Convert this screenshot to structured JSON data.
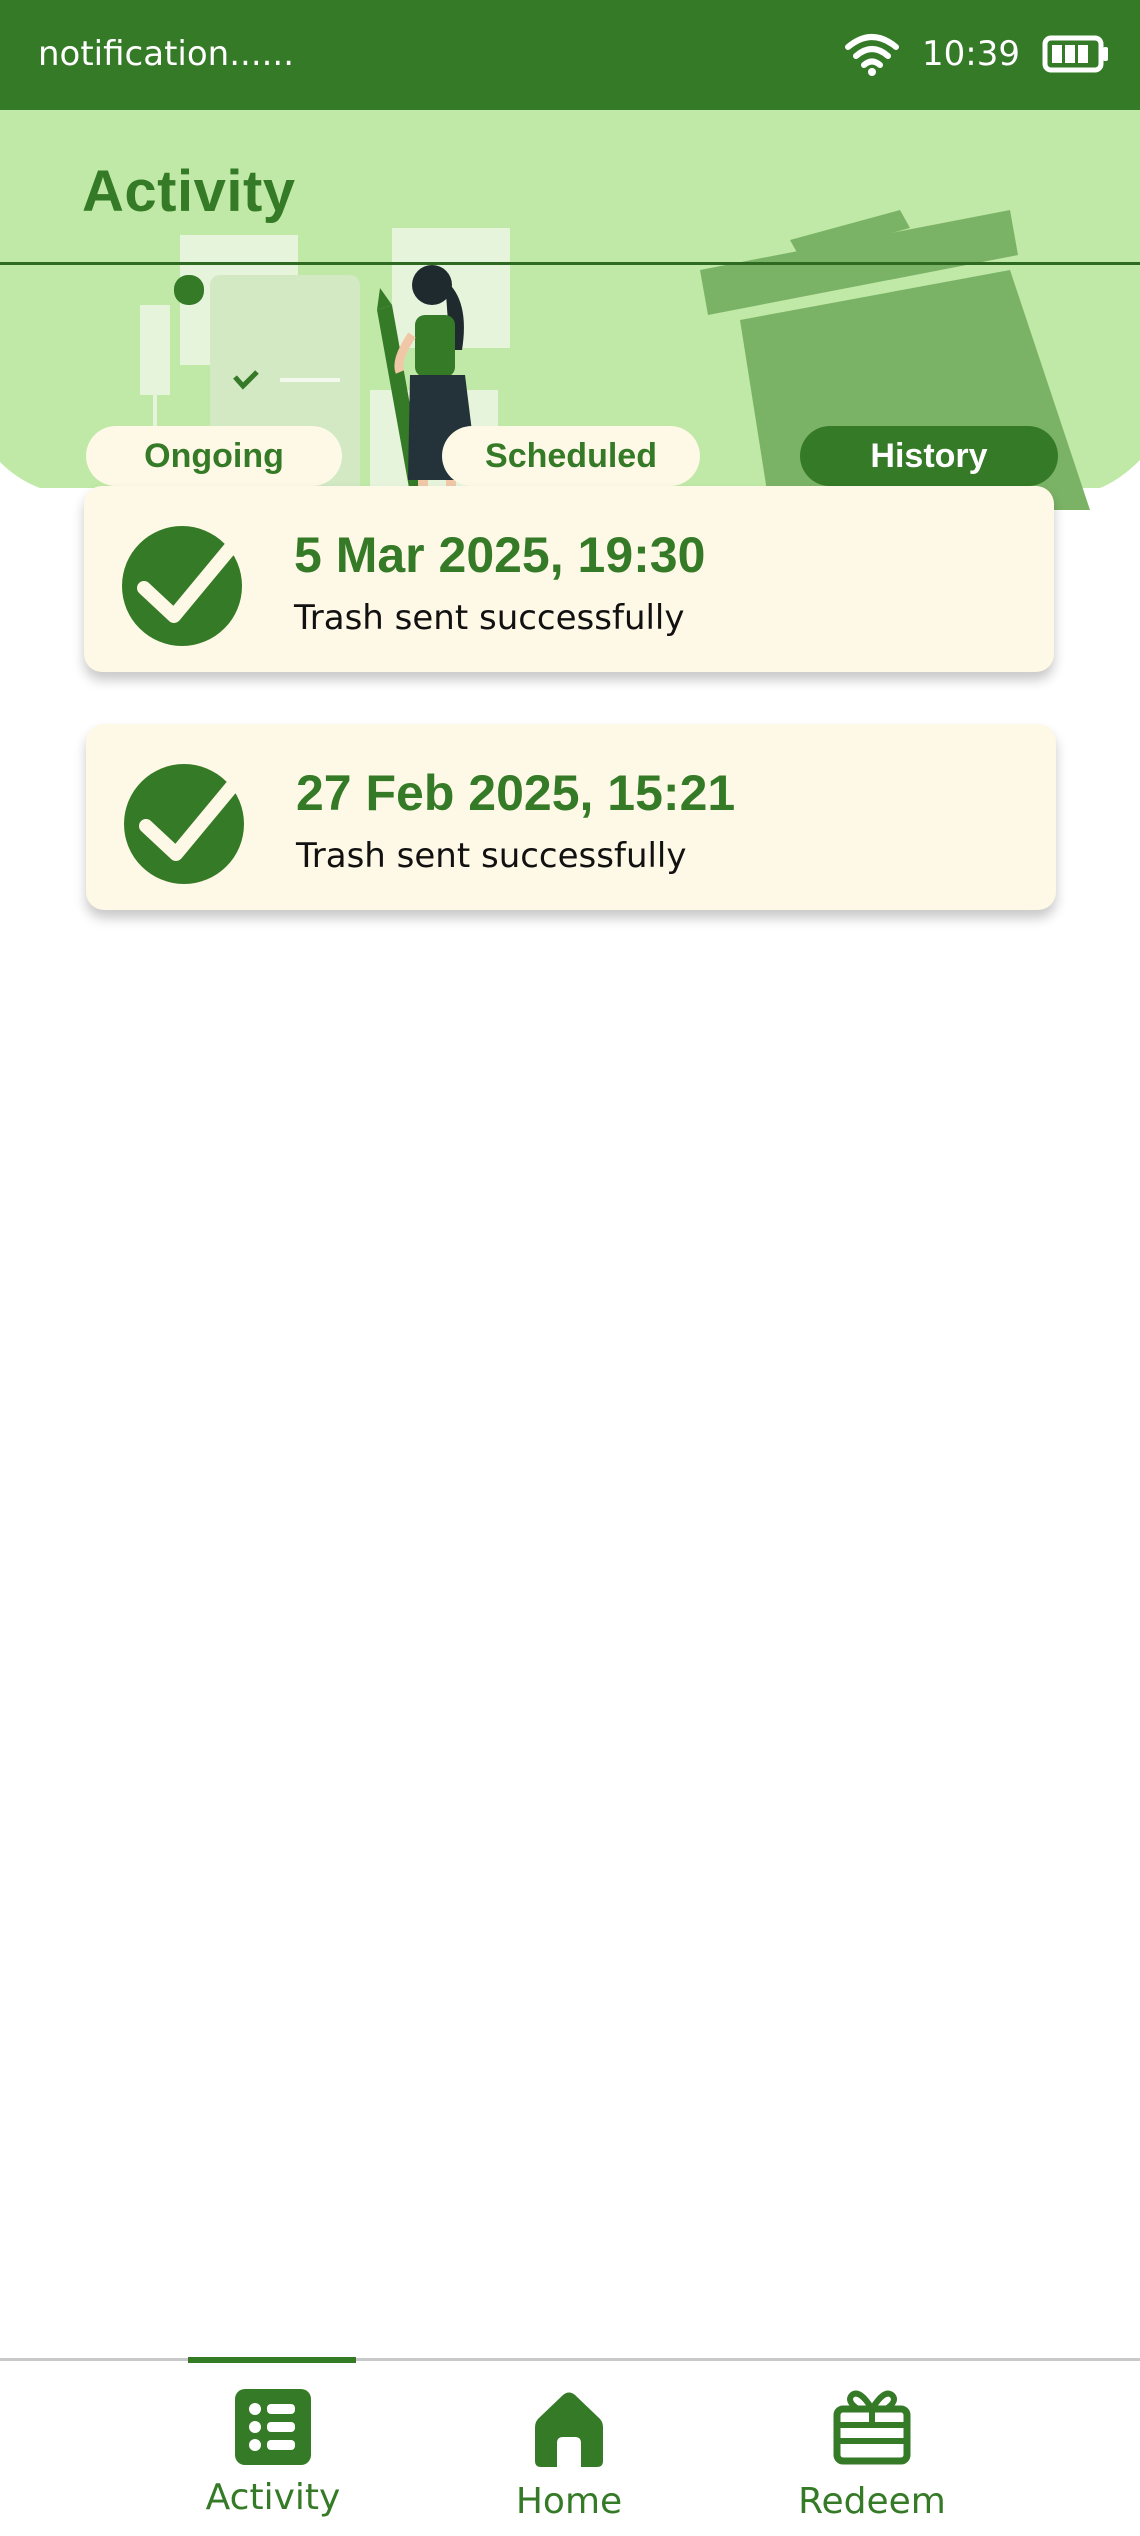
{
  "status_bar": {
    "notification_text": "notification......",
    "time": "10:39",
    "icons": [
      "wifi-icon",
      "battery-icon"
    ]
  },
  "header": {
    "title": "Activity",
    "illustration": "woman-with-checklist-and-trash-bin"
  },
  "tabs": [
    {
      "label": "Ongoing",
      "active": false
    },
    {
      "label": "Scheduled",
      "active": false
    },
    {
      "label": "History",
      "active": true
    }
  ],
  "history": [
    {
      "datetime": "5 Mar 2025, 19:30",
      "status": "Trash sent successfully",
      "icon": "check-circle-icon"
    },
    {
      "datetime": "27 Feb 2025, 15:21",
      "status": "Trash sent successfully",
      "icon": "check-circle-icon"
    }
  ],
  "bottom_nav": [
    {
      "label": "Activity",
      "icon": "list-icon",
      "active": true
    },
    {
      "label": "Home",
      "icon": "home-icon",
      "active": false
    },
    {
      "label": "Redeem",
      "icon": "gift-icon",
      "active": false
    }
  ],
  "colors": {
    "primary": "#357a27",
    "header_bg": "#c0e9a7",
    "card_bg": "#fef8e6",
    "tab_inactive_bg": "#fef8e6"
  }
}
